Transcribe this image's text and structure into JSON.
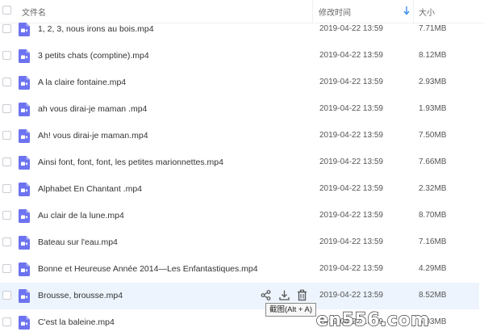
{
  "header": {
    "name_label": "文件名",
    "time_label": "修改时间",
    "size_label": "大小",
    "sort_icon": "arrow-down-icon",
    "sort_color": "#3b8cf2"
  },
  "file_icon_color": "#6d73f0",
  "files": [
    {
      "name": "1, 2, 3, nous irons au bois.mp4",
      "time": "2019-04-22 13:59",
      "size": "7.71MB"
    },
    {
      "name": "3 petits chats (comptine).mp4",
      "time": "2019-04-22 13:59",
      "size": "8.12MB"
    },
    {
      "name": "A la claire fontaine.mp4",
      "time": "2019-04-22 13:59",
      "size": "2.93MB"
    },
    {
      "name": "ah vous dirai-je maman .mp4",
      "time": "2019-04-22 13:59",
      "size": "1.93MB"
    },
    {
      "name": "Ah! vous dirai-je maman.mp4",
      "time": "2019-04-22 13:59",
      "size": "7.50MB"
    },
    {
      "name": "Ainsi font, font, font, les petites marionnettes.mp4",
      "time": "2019-04-22 13:59",
      "size": "7.66MB"
    },
    {
      "name": "Alphabet En Chantant .mp4",
      "time": "2019-04-22 13:59",
      "size": "2.32MB"
    },
    {
      "name": "Au clair de la lune.mp4",
      "time": "2019-04-22 13:59",
      "size": "8.70MB"
    },
    {
      "name": "Bateau sur l'eau.mp4",
      "time": "2019-04-22 13:59",
      "size": "7.16MB"
    },
    {
      "name": "Bonne et Heureuse Année 2014—Les Enfantastiques.mp4",
      "time": "2019-04-22 13:59",
      "size": "4.29MB"
    },
    {
      "name": "Brousse, brousse.mp4",
      "time": "2019-04-22 13:59",
      "size": "8.52MB"
    },
    {
      "name": "C'est la baleine.mp4",
      "time": "2019-04-22 13:59",
      "size": "6.03MB"
    }
  ],
  "hover_actions": {
    "share_icon": "share-icon",
    "download_icon": "download-icon",
    "delete_icon": "trash-icon"
  },
  "tooltip": "截图(Alt + A)",
  "watermark": "en556.com"
}
